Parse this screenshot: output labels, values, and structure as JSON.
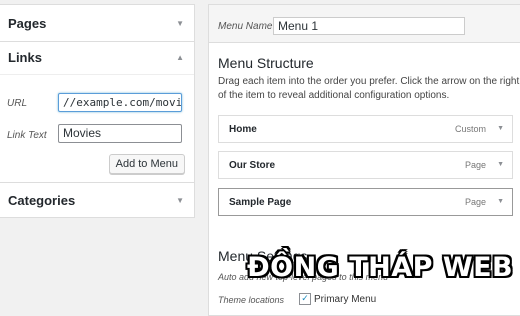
{
  "left_panel": {
    "pages": {
      "title": "Pages",
      "arrow": "▼"
    },
    "links": {
      "title": "Links",
      "arrow": "▲",
      "url_label": "URL",
      "url_value": "//example.com/movies",
      "link_text_label": "Link Text",
      "link_text_value": "Movies",
      "add_button": "Add to Menu"
    },
    "categories": {
      "title": "Categories",
      "arrow": "▼"
    }
  },
  "menu": {
    "name_label": "Menu Name",
    "name_value": "Menu 1",
    "structure_title": "Menu Structure",
    "instructions": "Drag each item into the order you prefer. Click the arrow on the right of the item to reveal additional configuration options.",
    "items": [
      {
        "title": "Home",
        "type": "Custom",
        "arrow": "▼"
      },
      {
        "title": "Our Store",
        "type": "Page",
        "arrow": "▼"
      },
      {
        "title": "Sample Page",
        "type": "Page",
        "arrow": "▼"
      }
    ],
    "settings_title": "Menu Settings",
    "auto_add_label": "Auto add new top-level pages to this menu",
    "theme_locations_label": "Theme locations",
    "primary_menu_label": "Primary Menu",
    "primary_menu_checked": "✓"
  },
  "watermark": "ĐỒNG THÁP WEB"
}
